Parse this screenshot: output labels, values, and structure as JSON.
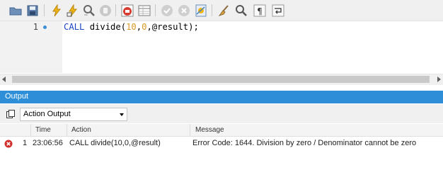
{
  "toolbar": {
    "icons": [
      "open-folder-icon",
      "save-icon",
      "execute-icon",
      "execute-current-icon",
      "find-icon",
      "stop-icon",
      "toggle-autocommit-icon",
      "toggle-results-icon",
      "commit-icon",
      "rollback-icon",
      "explain-icon",
      "beautify-icon",
      "search-replace-icon",
      "invisible-chars-icon",
      "word-wrap-icon"
    ]
  },
  "editor": {
    "line_number": "1",
    "code": {
      "keyword": "CALL",
      "name": " divide(",
      "arg1": "10",
      "comma1": ",",
      "arg2": "0",
      "rest": ",@result);"
    }
  },
  "output": {
    "title": "Output",
    "selector_value": "Action Output",
    "columns": {
      "index": "",
      "time": "Time",
      "action": "Action",
      "message": "Message"
    },
    "rows": [
      {
        "status": "error",
        "index": "1",
        "time": "23:06:56",
        "action": "CALL divide(10,0,@result)",
        "message": "Error Code: 1644. Division by zero / Denominator cannot be zero"
      }
    ]
  },
  "colors": {
    "accent": "#2e8fd8",
    "keyword": "#1d43c6",
    "number": "#d99a2b",
    "error": "#d0312d"
  }
}
